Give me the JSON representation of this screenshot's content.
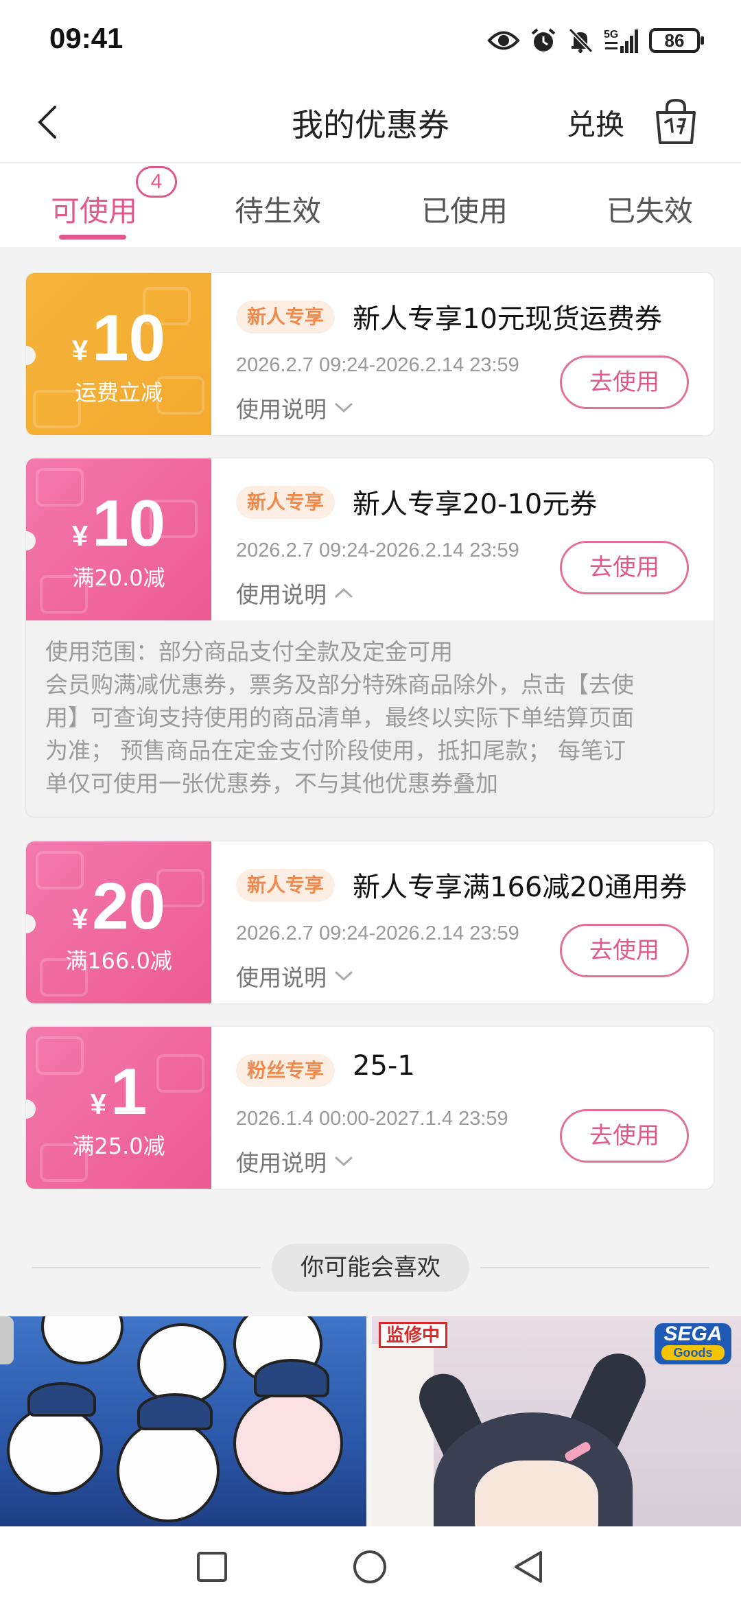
{
  "status_bar": {
    "time": "09:41",
    "network": "5G",
    "battery": "86",
    "icons": [
      "eye-icon",
      "alarm-icon",
      "mute-bell-icon",
      "signal-icon",
      "battery-icon"
    ]
  },
  "header": {
    "title": "我的优惠券",
    "redeem_label": "兑换",
    "back_icon": "chevron-left-icon",
    "bag_icon": "shopping-bag-icon"
  },
  "tabs": {
    "items": [
      {
        "label": "可使用",
        "active": true
      },
      {
        "label": "待生效",
        "active": false
      },
      {
        "label": "已使用",
        "active": false
      },
      {
        "label": "已失效",
        "active": false
      }
    ],
    "available_count": "4"
  },
  "coupons": [
    {
      "currency": "¥",
      "amount": "10",
      "condition": "运费立减",
      "color": "#f5ae35",
      "tag": "新人专享",
      "title": "新人专享10元现货运费券",
      "validity": "2026.2.7 09:24-2026.2.14 23:59",
      "instructions_label": "使用说明",
      "expanded": false,
      "button_label": "去使用"
    },
    {
      "currency": "¥",
      "amount": "10",
      "condition": "满20.0减",
      "color": "#ee6398",
      "tag": "新人专享",
      "title": "新人专享20-10元券",
      "validity": "2026.2.7 09:24-2026.2.14 23:59",
      "instructions_label": "使用说明",
      "expanded": true,
      "button_label": "去使用",
      "details": [
        "使用范围：部分商品支付全款及定金可用",
        "会员购满减优惠券，票务及部分特殊商品除外，点击【去使",
        "用】可查询支持使用的商品清单，最终以实际下单结算页面",
        "为准； 预售商品在定金支付阶段使用，抵扣尾款； 每笔订",
        "单仅可使用一张优惠券，不与其他优惠券叠加"
      ]
    },
    {
      "currency": "¥",
      "amount": "20",
      "condition": "满166.0减",
      "color": "#ee6398",
      "tag": "新人专享",
      "title": "新人专享满166减20通用券",
      "validity": "2026.2.7 09:24-2026.2.14 23:59",
      "instructions_label": "使用说明",
      "expanded": false,
      "button_label": "去使用"
    },
    {
      "currency": "¥",
      "amount": "1",
      "condition": "满25.0减",
      "color": "#ee6398",
      "tag": "粉丝专享",
      "title": "25-1",
      "validity": "2026.1.4 00:00-2027.1.4 23:59",
      "instructions_label": "使用说明",
      "expanded": false,
      "button_label": "去使用"
    }
  ],
  "recommendation": {
    "label": "你可能会喜欢",
    "products": [
      {
        "image": "chiikawa-baseball-illustration"
      },
      {
        "image": "bunny-girl-plush-figure",
        "badge": "监修中",
        "brand": "SEGA",
        "brand_sub": "Goods"
      }
    ]
  },
  "nav_bar": {
    "icons": [
      "square-recents-icon",
      "circle-home-icon",
      "triangle-back-icon"
    ]
  }
}
